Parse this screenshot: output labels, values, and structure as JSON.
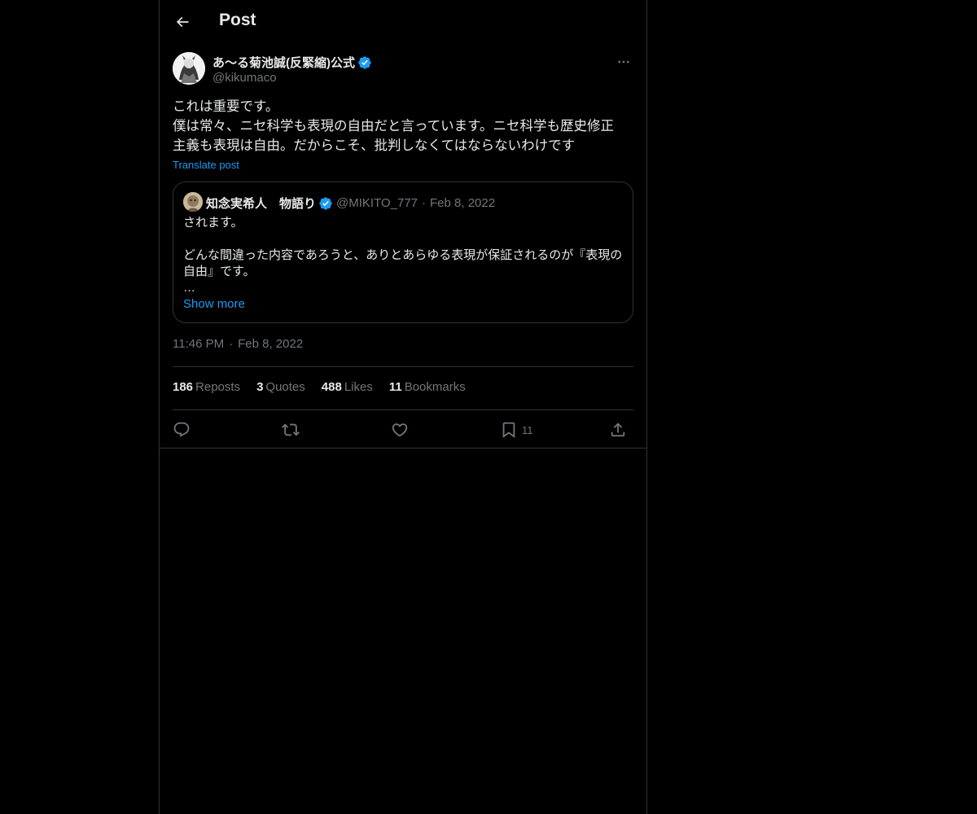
{
  "header": {
    "title": "Post"
  },
  "author": {
    "display_name": "あ〜る菊池誠(反緊縮)公式",
    "handle": "@kikumaco"
  },
  "post": {
    "lines": [
      "これは重要です。",
      "僕は常々、ニセ科学も表現の自由だと言っています。ニセ科学も歴史修正",
      "主義も表現は自由。だからこそ、批判しなくてはならないわけです"
    ],
    "translate_label": "Translate post"
  },
  "quote": {
    "name": "知念実希人　物語り",
    "handle": "@MIKITO_777",
    "dot": "·",
    "date": "Feb 8, 2022",
    "lines": [
      "されます。",
      "",
      "どんな間違った内容であろうと、ありとあらゆる表現が保証されるのが『表現の",
      "自由』です。",
      "…"
    ],
    "show_more": "Show more"
  },
  "timestamp": {
    "time": "11:46 PM",
    "sep": "·",
    "date": "Feb 8, 2022"
  },
  "stats": {
    "reposts": {
      "num": "186",
      "label": "Reposts"
    },
    "quotes": {
      "num": "3",
      "label": "Quotes"
    },
    "likes": {
      "num": "488",
      "label": "Likes"
    },
    "bookmarks": {
      "num": "11",
      "label": "Bookmarks"
    }
  },
  "actions": {
    "bookmark_count": "11"
  },
  "icons": {
    "back": "back-arrow-icon",
    "more": "more-icon",
    "verified": "verified-badge-icon",
    "reply": "reply-icon",
    "repost": "repost-icon",
    "like": "like-icon",
    "bookmark": "bookmark-icon",
    "share": "share-icon"
  },
  "colors": {
    "accent": "#1d9bf0",
    "text": "#e7e9ea",
    "muted": "#71767b",
    "border": "#2f3336",
    "background": "#000000"
  }
}
